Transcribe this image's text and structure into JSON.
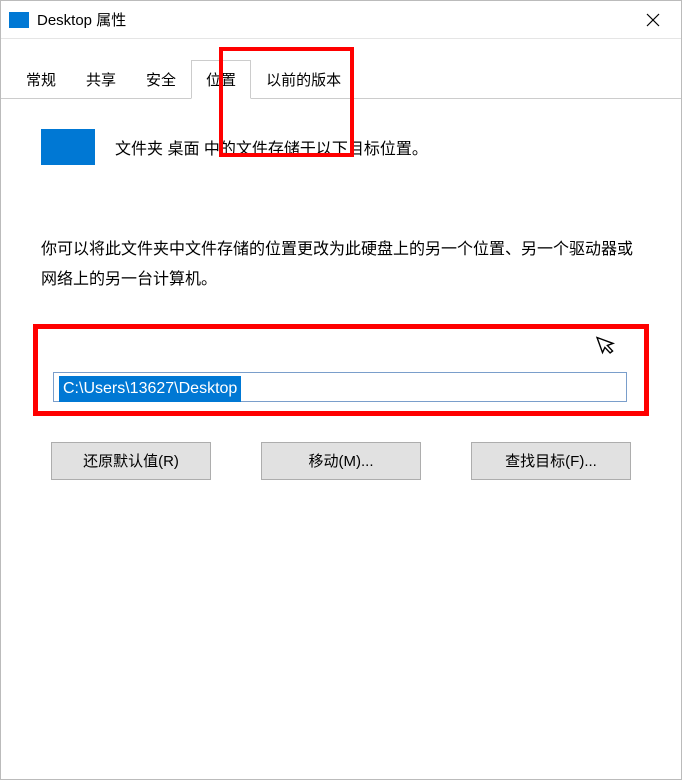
{
  "window": {
    "title": "Desktop 属性"
  },
  "tabs": {
    "items": [
      {
        "label": "常规"
      },
      {
        "label": "共享"
      },
      {
        "label": "安全"
      },
      {
        "label": "位置"
      },
      {
        "label": "以前的版本"
      }
    ],
    "active_index": 3
  },
  "content": {
    "heading": "文件夹 桌面 中的文件存储于以下目标位置。",
    "description": "你可以将此文件夹中文件存储的位置更改为此硬盘上的另一个位置、另一个驱动器或网络上的另一台计算机。",
    "path_value": "C:\\Users\\13627\\Desktop"
  },
  "buttons": {
    "restore": "还原默认值(R)",
    "move": "移动(M)...",
    "find": "查找目标(F)..."
  }
}
